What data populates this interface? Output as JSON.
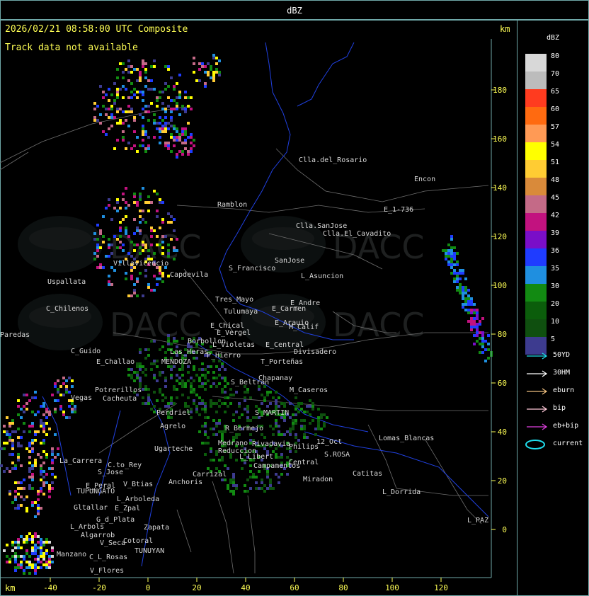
{
  "window": {
    "title": "dBZ"
  },
  "map": {
    "timestamp": "2026/02/21 08:58:00 UTC Composite",
    "track_message": "Track data not available",
    "km_label_top": "km",
    "km_label_bottom": "km",
    "watermark": "DACC",
    "x_ticks": [
      "-40",
      "-20",
      "0",
      "20",
      "40",
      "60",
      "80",
      "100",
      "120"
    ],
    "y_ticks": [
      "180",
      "160",
      "140",
      "120",
      "100",
      "80",
      "60",
      "40",
      "20",
      "0"
    ],
    "places": [
      "Clla.del_Rosario",
      "Encon",
      "E_1-736",
      "Ramblon",
      "Clla.SanJose",
      "Clla.El_Cavadito",
      "Villavicencio",
      "Capdevila",
      "S_Francisco",
      "SanJose",
      "L_Asuncion",
      "Uspallata",
      "Tres_Mayo",
      "E_Andre",
      "C_Chilenos",
      "Tulumaya",
      "E_Carmen",
      "E_Arauio",
      "M_Calif",
      "E_Chical",
      "E_Vergel",
      "Borbollon",
      "Divisadero",
      "Las_Heras",
      "L_Violetas",
      "E_Central",
      "C_Guido",
      "E_Challao",
      "MENDOZA",
      "P_Hierro",
      "T_Porteñas",
      "Chapanay",
      "S_Beltran",
      "M_Caseros",
      "Potrerillos",
      "Cacheuta",
      "Vegas",
      "Perdriel",
      "S_MARTIN",
      "Agrelo",
      "R_Bermejo",
      "Ugarteche",
      "Medrano",
      "Reduccion",
      "Rivadavia",
      "Philips",
      "12_Oct",
      "Lomas_Blancas",
      "S.ROSA",
      "La_Carrera",
      "C.to_Rey",
      "S_Jose",
      "Carrizal",
      "L_Libert",
      "Campamentos",
      "Central",
      "Catitas",
      "V_Btias",
      "Anchoris",
      "Miradon",
      "E_Peral",
      "TUPUNGATO",
      "L_Arboleda",
      "L_Dorrida",
      "Gltallar",
      "E_Zpal",
      "L_Arbols",
      "G_d_Plata",
      "Zapata",
      "L_PAZ",
      "Algarrob",
      "V_Seca",
      "Cotoral",
      "TUNUYAN",
      "Manzano",
      "C_L_Rosas",
      "V_Flores",
      "Paredas"
    ],
    "precip_color": "#2a6e1a",
    "storm_color": "#1a9fd8"
  },
  "legend": {
    "title": "dBZ",
    "levels": [
      {
        "label": "80",
        "color": "#d8d8d8"
      },
      {
        "label": "70",
        "color": "#bcbcbc"
      },
      {
        "label": "65",
        "color": "#ff3b1f"
      },
      {
        "label": "60",
        "color": "#ff6a10"
      },
      {
        "label": "57",
        "color": "#ff9a55"
      },
      {
        "label": "54",
        "color": "#ffff00"
      },
      {
        "label": "51",
        "color": "#ffcc33"
      },
      {
        "label": "48",
        "color": "#d98a3a"
      },
      {
        "label": "45",
        "color": "#c46a87"
      },
      {
        "label": "42",
        "color": "#c2127f"
      },
      {
        "label": "39",
        "color": "#7a0ec8"
      },
      {
        "label": "36",
        "color": "#1f3cff"
      },
      {
        "label": "35",
        "color": "#1f8fe0"
      },
      {
        "label": "30",
        "color": "#128a12"
      },
      {
        "label": "20",
        "color": "#0b5d0b"
      },
      {
        "label": "10",
        "color": "#0f4f0f"
      },
      {
        "label": "5",
        "color": "#3d3b8f"
      }
    ],
    "tracks": [
      {
        "label": "50YD",
        "color": "#20e0f0",
        "shape": "arrow"
      },
      {
        "label": "30HM",
        "color": "#ffffff",
        "shape": "arrow"
      },
      {
        "label": "eburn",
        "color": "#f0c080",
        "shape": "arrow"
      },
      {
        "label": "bip",
        "color": "#ffc8d8",
        "shape": "arrow"
      },
      {
        "label": "eb+bip",
        "color": "#e040e0",
        "shape": "arrow"
      },
      {
        "label": "current",
        "color": "#20e0f0",
        "shape": "ellipse"
      }
    ]
  }
}
